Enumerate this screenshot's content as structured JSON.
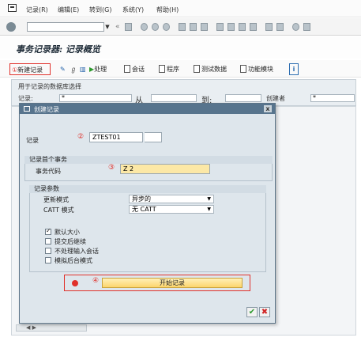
{
  "menu": {
    "items": [
      "记录(R)",
      "编辑(E)",
      "转到(G)",
      "系统(Y)",
      "帮助(H)"
    ]
  },
  "toolbar": {
    "command_value": "",
    "dropdown_glyph": "▼",
    "back_glyph": "«"
  },
  "page": {
    "title": "事务记录器: 记录概览"
  },
  "app_toolbar": {
    "new_record": "新建记录",
    "process": "处理",
    "session": "会话",
    "program": "程序",
    "test_data": "测试数据",
    "function_module": "功能模块",
    "info_glyph": "i",
    "marker_1": "①"
  },
  "selection": {
    "header": "用于记录的数据库选择",
    "record_label": "记录:",
    "record_value": "*",
    "from_label": "从",
    "to_label": "到:",
    "creator_label": "创建者",
    "creator_value": "*"
  },
  "dialog": {
    "title": "创建记录",
    "close_glyph": "x",
    "record_label": "记录",
    "record_value": "ZTEST01",
    "marker_2": "②",
    "transaction_group": "记录首个事务",
    "tcode_label": "事务代码",
    "tcode_value": "Z    2",
    "marker_3": "③",
    "params_group": "记录参数",
    "update_mode_label": "更新模式",
    "update_mode_value": "异步的",
    "catt_label": "CATT 模式",
    "catt_value": "无 CATT",
    "options": [
      {
        "label": "默认大小",
        "checked": true
      },
      {
        "label": "提交后继续",
        "checked": false
      },
      {
        "label": "不处理输入会话",
        "checked": false
      },
      {
        "label": "模拟后台模式",
        "checked": false
      }
    ],
    "start_button": "开始记录",
    "marker_4": "④",
    "confirm_glyph": "✔",
    "cancel_glyph": "✖"
  },
  "colors": {
    "accent_red": "#e0312b",
    "dialog_title_bar": "#57748d",
    "start_button": "#fcd56b"
  }
}
